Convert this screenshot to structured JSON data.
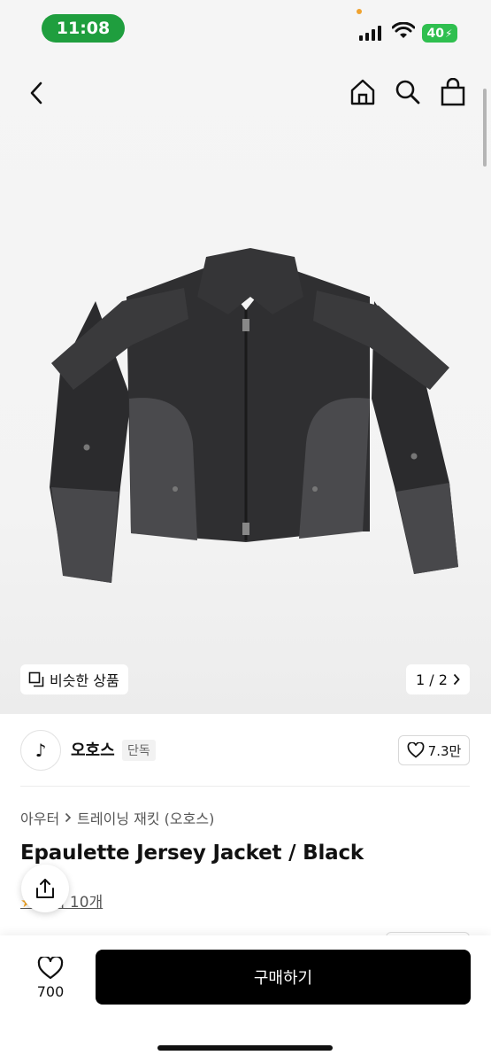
{
  "status_bar": {
    "time": "11:08",
    "battery": "40",
    "icons": [
      "signal-icon",
      "wifi-icon",
      "battery-icon"
    ]
  },
  "nav": {
    "icons": [
      "back-icon",
      "home-icon",
      "search-icon",
      "shopping-bag-icon"
    ]
  },
  "gallery": {
    "similar_label": "비슷한 상품",
    "pager": "1 / 2"
  },
  "shop": {
    "logo_text": "♪",
    "name": "오호스",
    "badge": "단독",
    "likes": "7.3만"
  },
  "product": {
    "breadcrumb": [
      "아우터",
      "트레이닝 재킷 (오호스)"
    ],
    "title": "Epaulette Jersey Jacket / Black",
    "review_text": "후기 10개"
  },
  "bottom": {
    "wish_count": "700",
    "buy_label": "구매하기"
  },
  "colors": {
    "status_time_bg": "#1f9e3e",
    "battery_bg": "#2fbf4f",
    "buy_button_bg": "#000000",
    "jacket_dark": "#2b2b2d",
    "jacket_light": "#4a4a4d"
  }
}
